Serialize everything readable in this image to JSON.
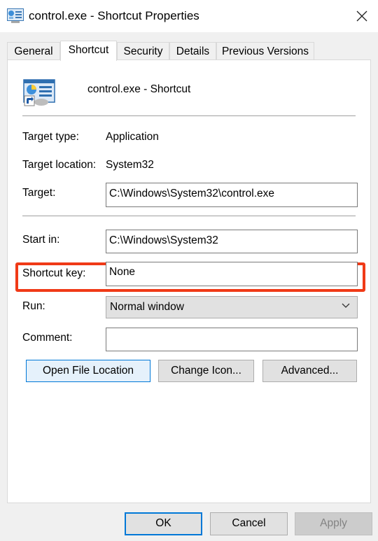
{
  "window": {
    "title": "control.exe - Shortcut Properties",
    "close_icon": "close-icon"
  },
  "tabs": [
    {
      "label": "General",
      "active": false
    },
    {
      "label": "Shortcut",
      "active": true
    },
    {
      "label": "Security",
      "active": false
    },
    {
      "label": "Details",
      "active": false
    },
    {
      "label": "Previous Versions",
      "active": false
    }
  ],
  "header": {
    "icon": "control-panel-shortcut-icon",
    "name": "control.exe - Shortcut"
  },
  "props": {
    "target_type_label": "Target type:",
    "target_type_value": "Application",
    "target_location_label": "Target location:",
    "target_location_value": "System32",
    "target_label": "Target:",
    "target_value": "C:\\Windows\\System32\\control.exe",
    "start_in_label": "Start in:",
    "start_in_value": "C:\\Windows\\System32",
    "shortcut_key_label": "Shortcut key:",
    "shortcut_key_value": "None",
    "run_label": "Run:",
    "run_value": "Normal window",
    "comment_label": "Comment:",
    "comment_value": ""
  },
  "buttons": {
    "open_file_location": "Open File Location",
    "change_icon": "Change Icon...",
    "advanced": "Advanced...",
    "ok": "OK",
    "cancel": "Cancel",
    "apply": "Apply"
  },
  "colors": {
    "highlight": "#f03a17",
    "accent": "#0078d7"
  }
}
